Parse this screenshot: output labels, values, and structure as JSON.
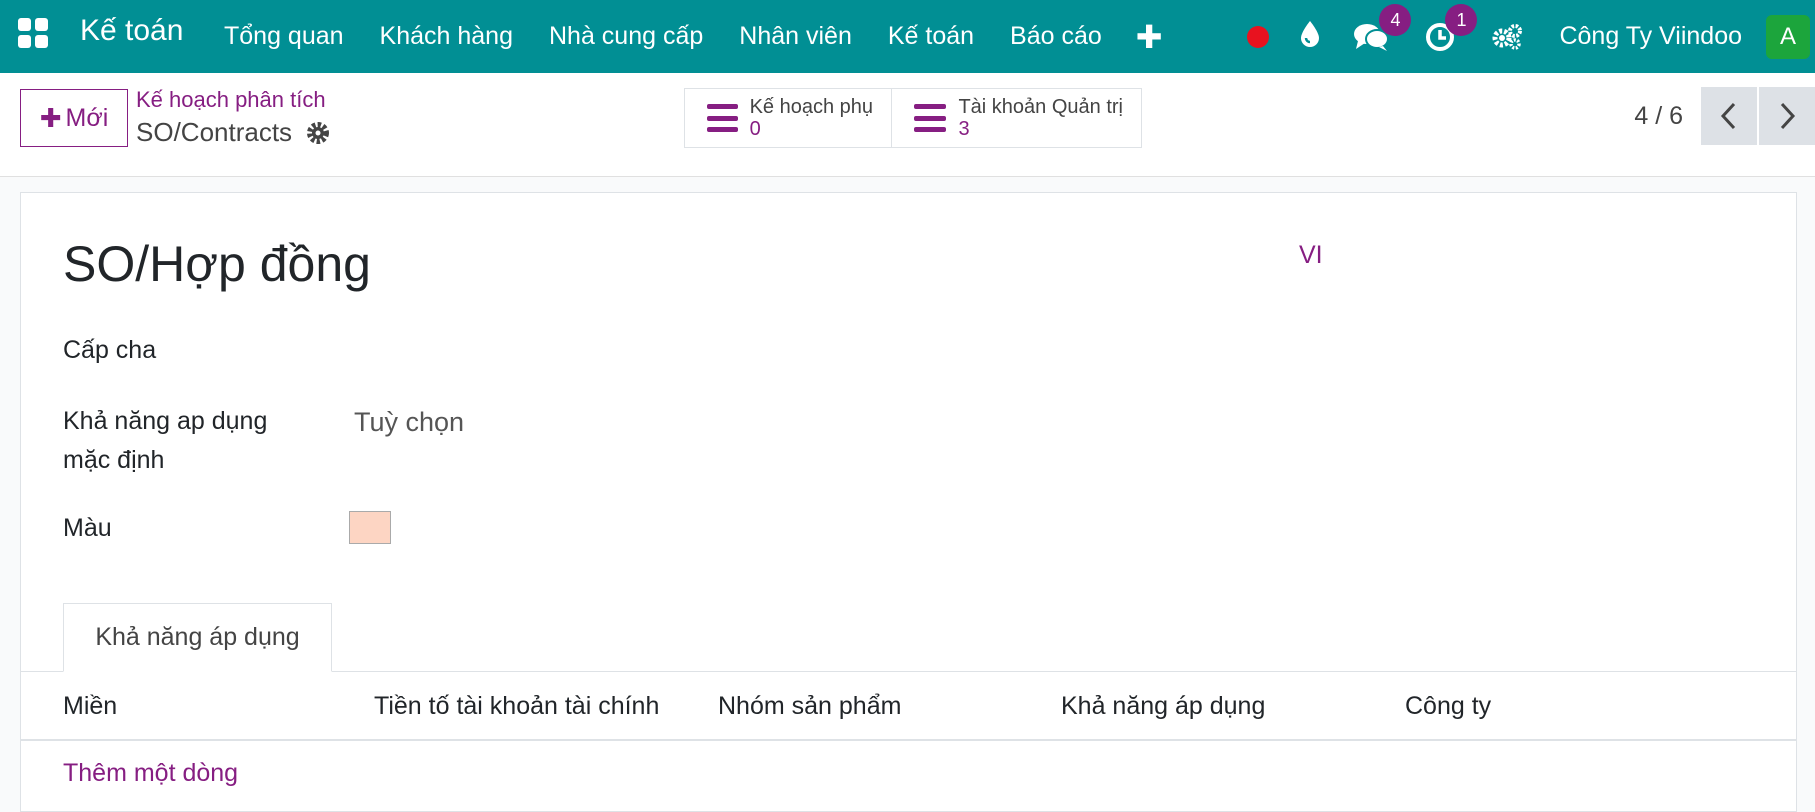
{
  "navbar": {
    "brand": "Kế toán",
    "menu": [
      "Tổng quan",
      "Khách hàng",
      "Nhà cung cấp",
      "Nhân viên",
      "Kế toán",
      "Báo cáo"
    ],
    "messages_badge": "4",
    "activities_badge": "1",
    "company": "Công Ty Viindoo",
    "avatar": "A",
    "colors": {
      "bar": "#018f94",
      "badge": "#861e82",
      "avatar": "#1ca53c",
      "record_dot": "#e8121f"
    }
  },
  "control_panel": {
    "new_label": "Mới",
    "breadcrumb": "Kế hoạch phân tích",
    "record_name": "SO/Contracts",
    "stat_buttons": [
      {
        "label": "Kế hoạch phụ",
        "value": "0"
      },
      {
        "label": "Tài khoản Quản trị",
        "value": "3"
      }
    ],
    "pager": "4 / 6"
  },
  "form": {
    "title": "SO/Hợp đồng",
    "lang": "VI",
    "fields": {
      "parent_label": "Cấp cha",
      "applicability_label_1": "Khả năng ap dụng",
      "applicability_label_2": "mặc định",
      "applicability_value": "Tuỳ chọn",
      "color_label": "Màu",
      "color_value": "#fdd5c3"
    },
    "tab": "Khả năng áp dụng",
    "table_columns": [
      "Miền",
      "Tiền tố tài khoản tài chính",
      "Nhóm sản phẩm",
      "Khả năng áp dụng",
      "Công ty"
    ],
    "add_line": "Thêm một dòng"
  }
}
